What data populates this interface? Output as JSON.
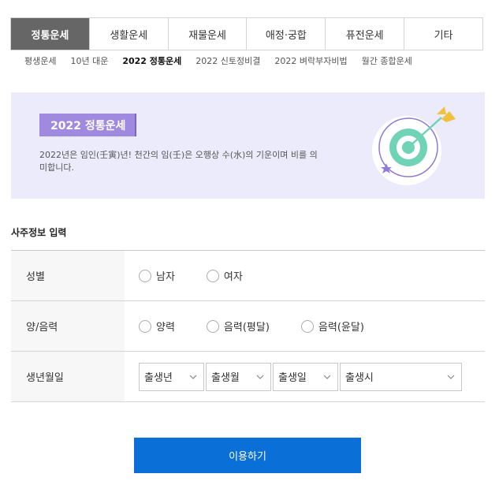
{
  "tabs": [
    {
      "label": "정통운세",
      "active": true
    },
    {
      "label": "생활운세",
      "active": false
    },
    {
      "label": "재물운세",
      "active": false
    },
    {
      "label": "애정·궁합",
      "active": false
    },
    {
      "label": "퓨전운세",
      "active": false
    },
    {
      "label": "기타",
      "active": false
    }
  ],
  "subnav": [
    {
      "label": "평생운세",
      "active": false
    },
    {
      "label": "10년 대운",
      "active": false
    },
    {
      "label": "2022 정통운세",
      "active": true
    },
    {
      "label": "2022 신토정비결",
      "active": false
    },
    {
      "label": "2022 벼락부자비법",
      "active": false
    },
    {
      "label": "월간 종합운세",
      "active": false
    }
  ],
  "banner": {
    "title": "2022 정통운세",
    "description": "2022년은 임인(壬寅)년! 천간의 임(壬)은 오행상 수(水)의 기운이며 비를 의미합니다.",
    "icon": "target-arrow-icon",
    "colors": {
      "background": "#ecebfb",
      "badge": "#a08ae0",
      "target": "#6fd3b5",
      "arrow_tip": "#f2c13b",
      "star": "#8f7bd6"
    }
  },
  "form": {
    "section_title": "사주정보 입력",
    "rows": {
      "gender": {
        "label": "성별",
        "options": [
          "남자",
          "여자"
        ]
      },
      "calendar": {
        "label": "양/음력",
        "options": [
          "양력",
          "음력(평달)",
          "음력(윤달)"
        ]
      },
      "birth": {
        "label": "생년월일",
        "selects": {
          "year": "출생년",
          "month": "출생월",
          "day": "출생일",
          "hour": "출생시"
        }
      }
    }
  },
  "submit": {
    "label": "이용하기",
    "color": "#0a6fd6"
  }
}
